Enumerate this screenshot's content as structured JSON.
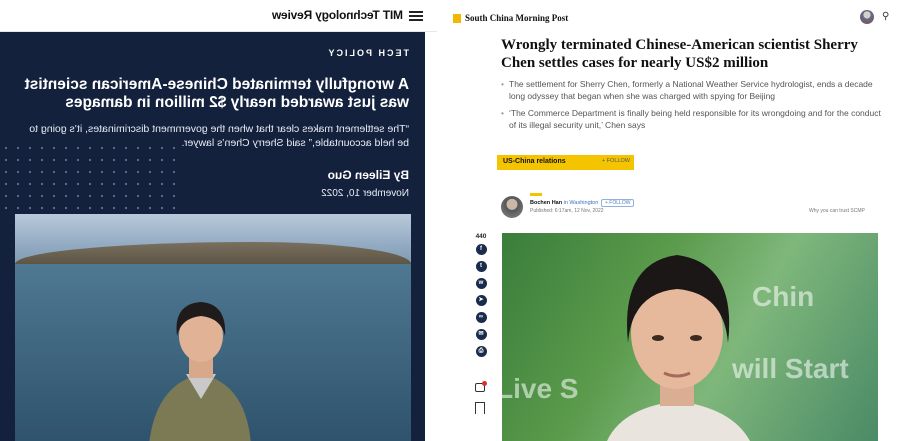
{
  "mit": {
    "brand": "MIT Technology Review",
    "section": "TECH POLICY",
    "headline": "A wrongfully terminated Chinese-American scientist was just awarded nearly $2 million in damages",
    "quote": "“The settlement makes clear that when the government discriminates, it’s going to be held accountable,” said Sherry Chen’s lawyer.",
    "byline": "By Eileen Guo",
    "date": "November 10, 2022",
    "colors": {
      "hero_bg": "#14213d"
    },
    "icons": [
      "menu-icon"
    ]
  },
  "scmp": {
    "brand": "South China Morning Post",
    "headline": "Wrongly terminated Chinese-American scientist Sherry Chen settles cases for nearly US$2 million",
    "bullets": [
      "The settlement for Sherry Chen, formerly a National Weather Service hydrologist, ends a decade long odyssey that began when she was charged with spying for Beijing",
      "‘The Commerce Department is finally being held responsible for its wrongdoing and for the conduct of its illegal security unit,’ Chen says"
    ],
    "topic_tag": "US-China relations",
    "tag_follow": "+ FOLLOW",
    "author_name": "Bochen Han",
    "author_location": "in Washington",
    "author_follow": "+ FOLLOW",
    "published": "Published: 6:17am, 12 Nov, 2022",
    "why_link": "Why you can trust SCMP",
    "share_count": "440",
    "share_icons": [
      "facebook-icon",
      "twitter-icon",
      "whatsapp-icon",
      "telegram-icon",
      "link-icon",
      "email-icon",
      "print-icon"
    ],
    "photo_bg_text": [
      "Chin",
      "Live S",
      "will Start"
    ],
    "colors": {
      "accent": "#f5c400",
      "icon_bg": "#1a2b4c"
    }
  }
}
